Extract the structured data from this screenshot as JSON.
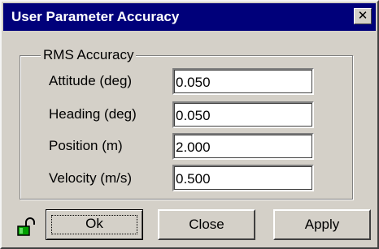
{
  "window": {
    "title": "User Parameter Accuracy",
    "close_glyph": "✕"
  },
  "group": {
    "title": "RMS Accuracy",
    "rows": [
      {
        "label": "Attitude (deg)",
        "value": "0.050"
      },
      {
        "label": "Heading (deg)",
        "value": "0.050"
      },
      {
        "label": "Position (m)",
        "value": "2.000"
      },
      {
        "label": "Velocity (m/s)",
        "value": "0.500"
      }
    ]
  },
  "buttons": {
    "ok": "Ok",
    "close": "Close",
    "apply": "Apply"
  },
  "icons": {
    "lock": "unlocked-padlock-icon",
    "lock_body_color": "#008000"
  }
}
